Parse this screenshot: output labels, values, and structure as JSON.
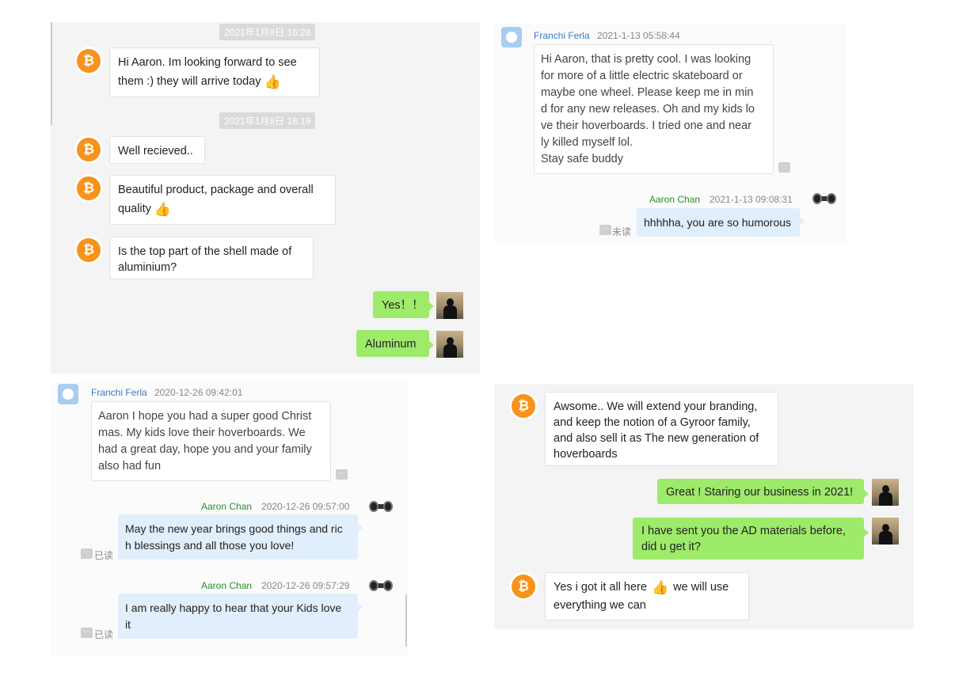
{
  "panel1": {
    "timestamp1": "2021年1月8日 16:28",
    "timestamp2": "2021年1月8日 18:19",
    "btc_symbol": "₿",
    "msg1_line1": "Hi Aaron. Im looking forward to see",
    "msg1_line2": "them :) they will arrive today",
    "msg2": "Well recieved..",
    "msg3_line1": "Beautiful product, package and overall",
    "msg3_line2": "quality",
    "msg4_line1": "Is the top part of the shell made of",
    "msg4_line2": "aluminium?",
    "reply1": "Yes！！",
    "reply2": "Aluminum",
    "thumb": "👍"
  },
  "panel2": {
    "sender": "Franchi Ferla",
    "sender_time": "2021-1-13 05:58:44",
    "msg_lines": [
      "Hi Aaron,  that is pretty cool. I was looking",
      " for more of a little electric skateboard or",
      "maybe one wheel.  Please keep me in min",
      "d for any new releases. Oh and my kids lo",
      "ve their hoverboards.  I tried one and near",
      "ly killed myself lol.",
      "Stay safe buddy"
    ],
    "reply_sender": "Aaron Chan",
    "reply_time": "2021-1-13 09:08:31",
    "reply": "hhhhha, you are so humorous",
    "read_status": "未读",
    "more": "···"
  },
  "panel3": {
    "sender": "Franchi Ferla",
    "sender_time": "2020-12-26 09:42:01",
    "msg_lines": [
      "Aaron I hope you had a super good Christ",
      "mas.  My kids love their hoverboards.  We",
      "had a great day, hope you and your family",
      " also had fun"
    ],
    "reply1_sender": "Aaron Chan",
    "reply1_time": "2020-12-26 09:57:00",
    "reply1_lines": [
      "May the new year brings good things and ric",
      "h blessings and all those you love!"
    ],
    "reply2_sender": "Aaron Chan",
    "reply2_time": "2020-12-26 09:57:29",
    "reply2_lines": [
      "I am really happy to hear that your Kids love",
      "it"
    ],
    "read_status": "已读",
    "more": "···"
  },
  "panel4": {
    "btc_symbol": "₿",
    "msg1_lines": [
      "Awsome.. We will extend your branding,",
      "and keep the notion of a Gyroor family,",
      "and also sell it as The new generation of",
      "hoverboards"
    ],
    "reply1": "Great ! Staring our business in 2021!",
    "reply2_lines": [
      "I have sent you the AD materials before,",
      "did u get it?"
    ],
    "msg2_part1": "Yes i got it all here",
    "msg2_part2": "we will use",
    "msg2_line2": "everything we can",
    "thumb": "👍"
  }
}
